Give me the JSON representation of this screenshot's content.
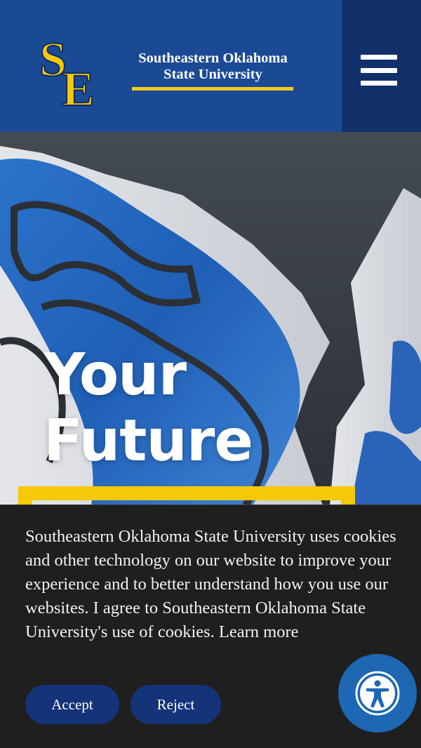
{
  "header": {
    "logo_monogram": "SE",
    "university_name_line1": "Southeastern Oklahoma",
    "university_name_line2": "State University",
    "menu_icon": "hamburger-menu-icon"
  },
  "hero": {
    "title_line1": "Your",
    "title_line2": "Future",
    "background": "blue-white-university-flags"
  },
  "cookie_banner": {
    "message": "Southeastern Oklahoma State University uses cookies and other technology on our website to improve your experience and to better understand how you use our websites. I agree to Southeastern Oklahoma State University's use of cookies.",
    "learn_more_label": "Learn more",
    "accept_label": "Accept",
    "reject_label": "Reject"
  },
  "accessibility": {
    "icon": "accessibility-person-icon"
  },
  "colors": {
    "header_blue": "#1b4a95",
    "menu_panel_navy": "#12306a",
    "brand_gold": "#f5c908",
    "banner_dark": "#1f1f1f",
    "button_navy": "#143379",
    "a11y_blue": "#1d67b3"
  }
}
